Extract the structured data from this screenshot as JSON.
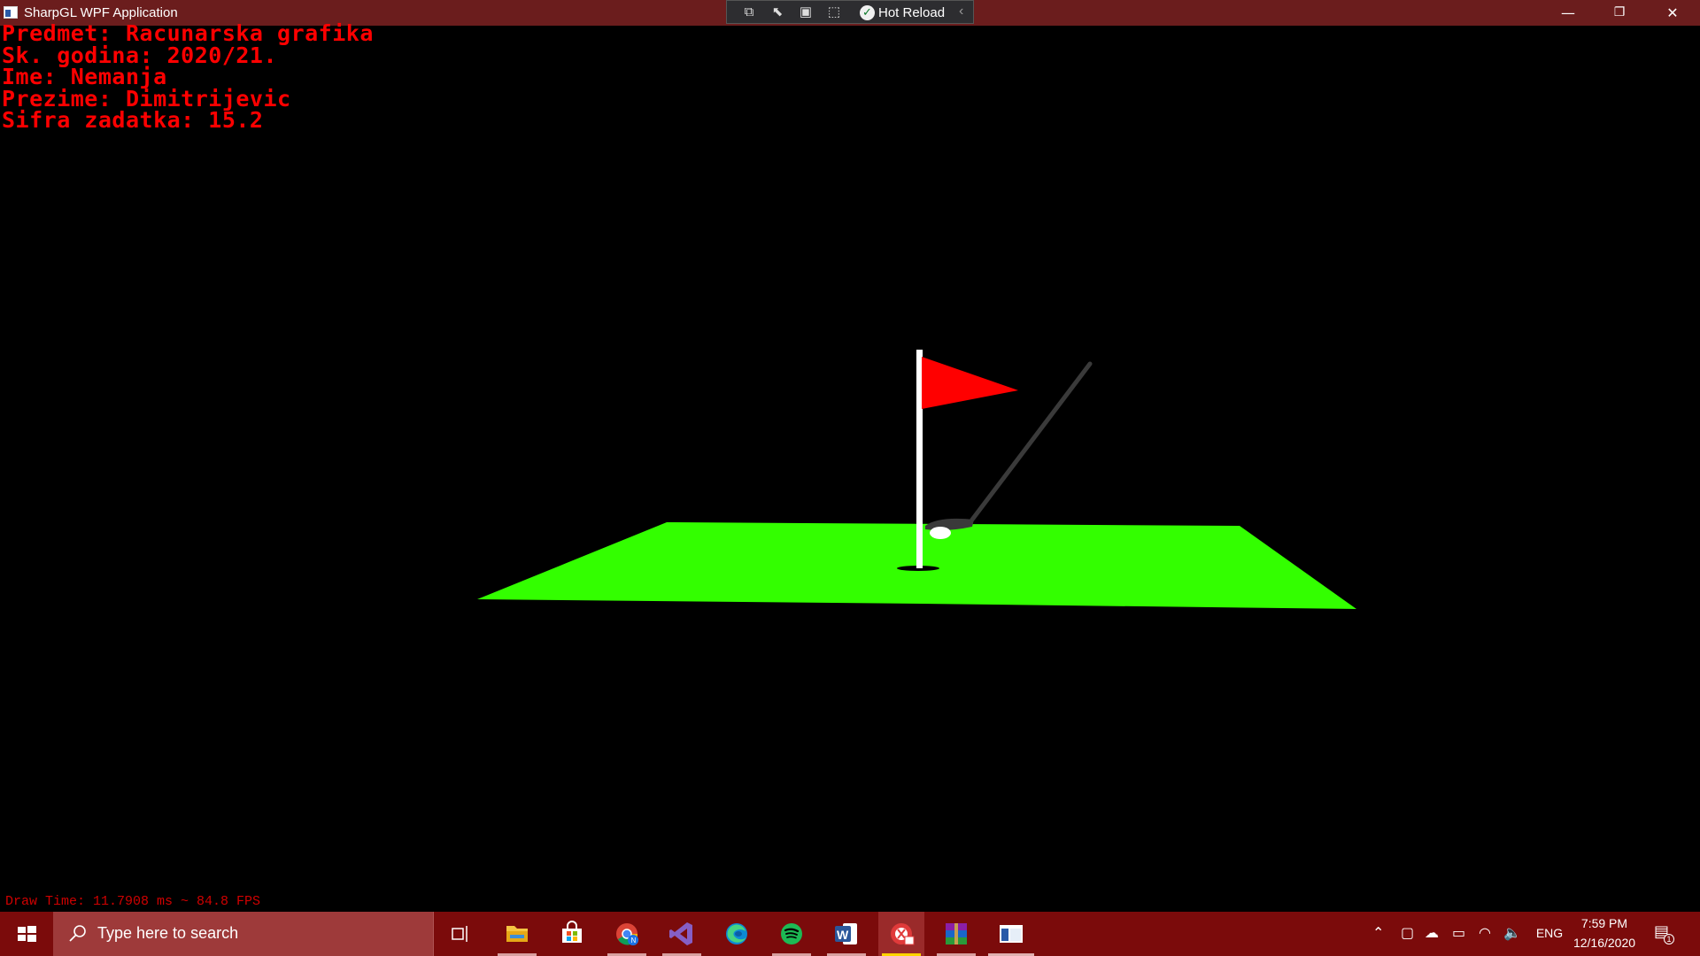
{
  "window": {
    "title": "SharpGL WPF Application",
    "minimize": "—",
    "maximize": "❐",
    "close": "✕"
  },
  "hot_reload": {
    "label": "Hot Reload",
    "check": "✓",
    "collapse": "‹"
  },
  "info_lines": {
    "predmet": "Predmet: Racunarska grafika",
    "godina": "Sk. godina: 2020/21.",
    "ime": "Ime: Nemanja",
    "prezime": "Prezime: Dimitrijevic",
    "sifra": "Sifra zadatka: 15.2"
  },
  "draw_time": "Draw Time: 11.7908 ms ~ 84.8 FPS",
  "colors": {
    "green": "#33ff00",
    "flag": "#ff0000",
    "pole": "#ffffff",
    "club": "#3a3a3a",
    "titlebar": "#6b1d1d",
    "taskbar": "#7b0b0b"
  },
  "taskbar": {
    "search_placeholder": "Type here to search",
    "apps": [
      "task-view",
      "file-explorer",
      "microsoft-store",
      "chrome",
      "visual-studio",
      "edge",
      "spotify",
      "word",
      "snipping-app",
      "winrar",
      "sharpgl-app"
    ],
    "tray": {
      "language": "ENG",
      "time": "7:59 PM",
      "date": "12/16/2020",
      "notifications": "1"
    }
  }
}
